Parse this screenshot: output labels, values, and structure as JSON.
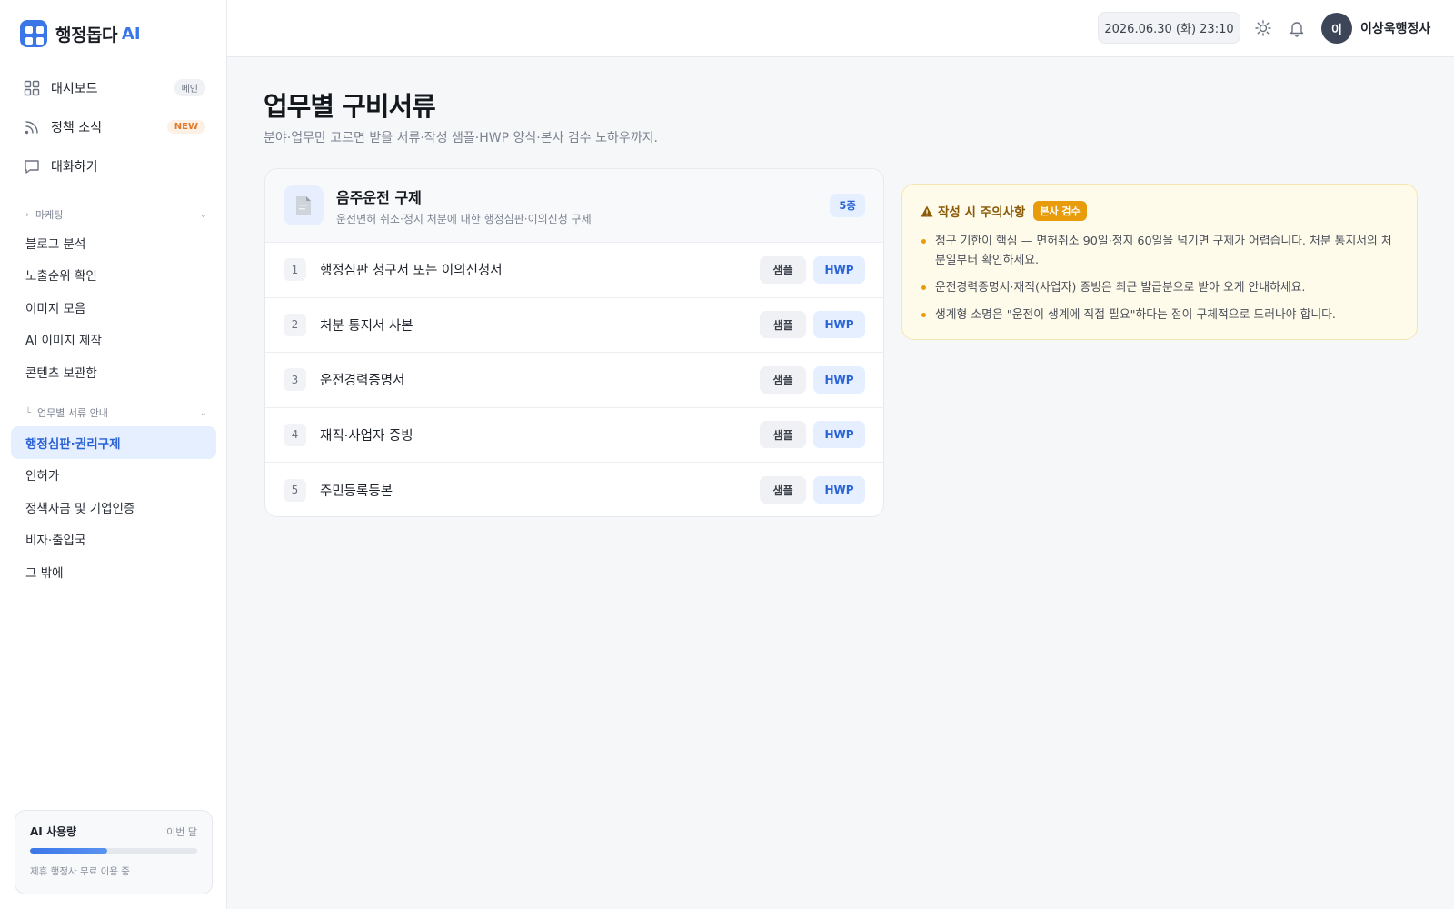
{
  "brand": {
    "name": "행정돕다",
    "ai": "AI",
    "accent": "#3a76e8"
  },
  "mainnav": [
    {
      "label": "대시보드",
      "badge": "메인",
      "icon": "grid-icon"
    },
    {
      "label": "정책 소식",
      "badge": "NEW",
      "icon": "rss-icon"
    },
    {
      "label": "대화하기",
      "badge": "",
      "icon": "chat-icon"
    }
  ],
  "marketing": {
    "heading": "마케팅",
    "items": [
      "블로그 분석",
      "노출순위 확인",
      "이미지 모음",
      "AI 이미지 제작",
      "콘텐츠 보관함"
    ]
  },
  "docs_guide": {
    "heading": "업무별 서류 안내",
    "items": [
      "행정심판·권리구제",
      "인허가",
      "정책자금 및 기업인증",
      "비자·출입국",
      "그 밖에"
    ],
    "active": "행정심판·권리구제"
  },
  "usage": {
    "title": "AI 사용량",
    "period": "이번 달",
    "progress": 0.46,
    "note": "제휴 행정사 무료 이용 중"
  },
  "topbar": {
    "datetime": "2026.06.30 (화) 23:10",
    "avatar_initial": "이",
    "username": "이상욱행정사"
  },
  "page": {
    "title": "업무별 구비서류",
    "subtitle": "분야·업무만 고르면 받을 서류·작성 샘플·HWP 양식·본사 검수 노하우까지."
  },
  "doc_card": {
    "title": "음주운전 구제",
    "desc": "운전면허 취소·정지 처분에 대한 행정심판·이의신청 구제",
    "count": "5종",
    "sample_label": "샘플",
    "hwp_label": "HWP",
    "rows": [
      {
        "num": "1",
        "label": "행정심판 청구서 또는 이의신청서"
      },
      {
        "num": "2",
        "label": "처분 통지서 사본"
      },
      {
        "num": "3",
        "label": "운전경력증명서"
      },
      {
        "num": "4",
        "label": "재직·사업자 증빙"
      },
      {
        "num": "5",
        "label": "주민등록등본"
      }
    ]
  },
  "notice": {
    "title": "작성 시 주의사항",
    "tag": "본사 검수",
    "items": [
      "청구 기한이 핵심 — 면허취소 90일·정지 60일을 넘기면 구제가 어렵습니다. 처분 통지서의 처분일부터 확인하세요.",
      "운전경력증명서·재직(사업자) 증빙은 최근 발급분으로 받아 오게 안내하세요.",
      "생계형 소명은 \"운전이 생계에 직접 필요\"하다는 점이 구체적으로 드러나야 합니다."
    ]
  }
}
